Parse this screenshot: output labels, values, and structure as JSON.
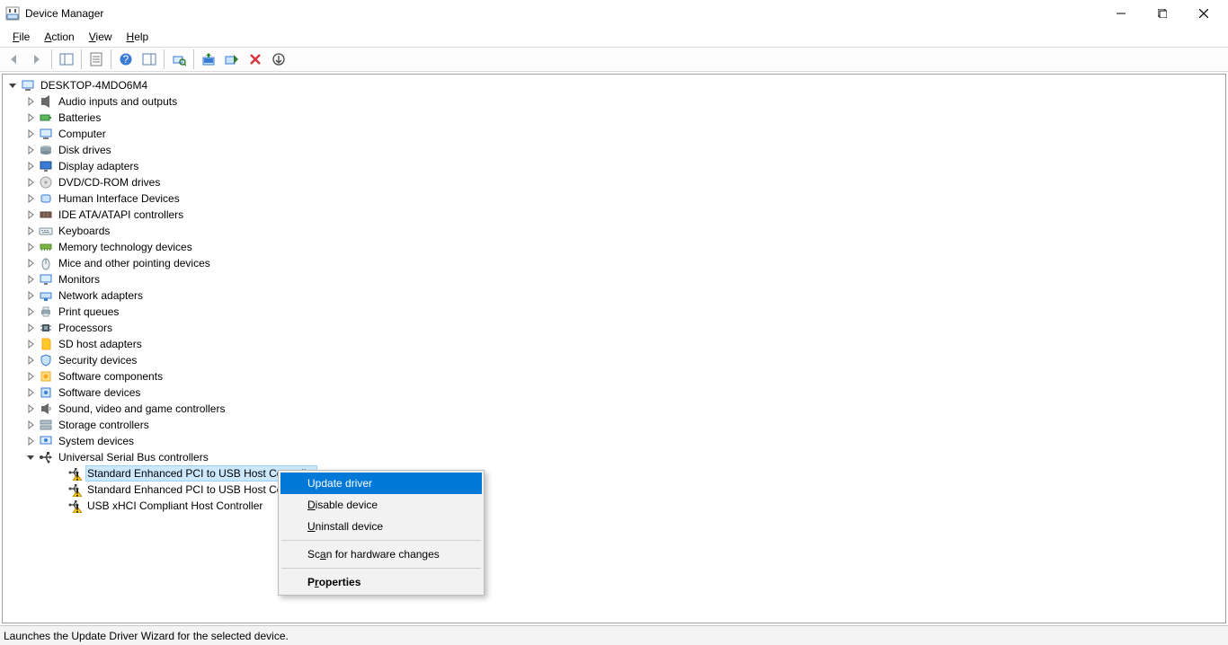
{
  "window": {
    "title": "Device Manager"
  },
  "menu": {
    "file": "File",
    "action": "Action",
    "view": "View",
    "help": "Help"
  },
  "toolbar": {
    "back": "Back",
    "forward": "Forward",
    "show_hide_tree": "Show/Hide Console Tree",
    "properties": "Properties",
    "help": "Help",
    "show_hide_action": "Show/Hide Action Pane",
    "scan": "Scan for hardware changes",
    "update": "Update Device Driver",
    "enable": "Enable device",
    "disable": "Disable device",
    "uninstall": "Uninstall device"
  },
  "tree": {
    "root": "DESKTOP-4MDO6M4",
    "categories": [
      {
        "label": "Audio inputs and outputs",
        "icon": "audio-icon"
      },
      {
        "label": "Batteries",
        "icon": "battery-icon"
      },
      {
        "label": "Computer",
        "icon": "computer-icon"
      },
      {
        "label": "Disk drives",
        "icon": "disk-icon"
      },
      {
        "label": "Display adapters",
        "icon": "display-icon"
      },
      {
        "label": "DVD/CD-ROM drives",
        "icon": "dvd-icon"
      },
      {
        "label": "Human Interface Devices",
        "icon": "hid-icon"
      },
      {
        "label": "IDE ATA/ATAPI controllers",
        "icon": "ide-icon"
      },
      {
        "label": "Keyboards",
        "icon": "keyboard-icon"
      },
      {
        "label": "Memory technology devices",
        "icon": "memory-icon"
      },
      {
        "label": "Mice and other pointing devices",
        "icon": "mouse-icon"
      },
      {
        "label": "Monitors",
        "icon": "monitor-icon"
      },
      {
        "label": "Network adapters",
        "icon": "network-icon"
      },
      {
        "label": "Print queues",
        "icon": "printer-icon"
      },
      {
        "label": "Processors",
        "icon": "cpu-icon"
      },
      {
        "label": "SD host adapters",
        "icon": "sd-icon"
      },
      {
        "label": "Security devices",
        "icon": "security-icon"
      },
      {
        "label": "Software components",
        "icon": "swcomp-icon"
      },
      {
        "label": "Software devices",
        "icon": "swdev-icon"
      },
      {
        "label": "Sound, video and game controllers",
        "icon": "sound-icon"
      },
      {
        "label": "Storage controllers",
        "icon": "storage-icon"
      },
      {
        "label": "System devices",
        "icon": "system-icon"
      }
    ],
    "usb_category": {
      "label": "Universal Serial Bus controllers",
      "icon": "usb-icon"
    },
    "usb_children": [
      {
        "label": "Standard Enhanced PCI to USB Host Controller",
        "warn": true,
        "selected": true
      },
      {
        "label": "Standard Enhanced PCI to USB Host Cont",
        "warn": true,
        "selected": false
      },
      {
        "label": "USB xHCI Compliant Host Controller",
        "warn": true,
        "selected": false
      }
    ]
  },
  "context_menu": {
    "update": "Update driver",
    "disable": "Disable device",
    "uninstall": "Uninstall device",
    "scan": "Scan for hardware changes",
    "properties": "Properties"
  },
  "status": {
    "text": "Launches the Update Driver Wizard for the selected device."
  }
}
